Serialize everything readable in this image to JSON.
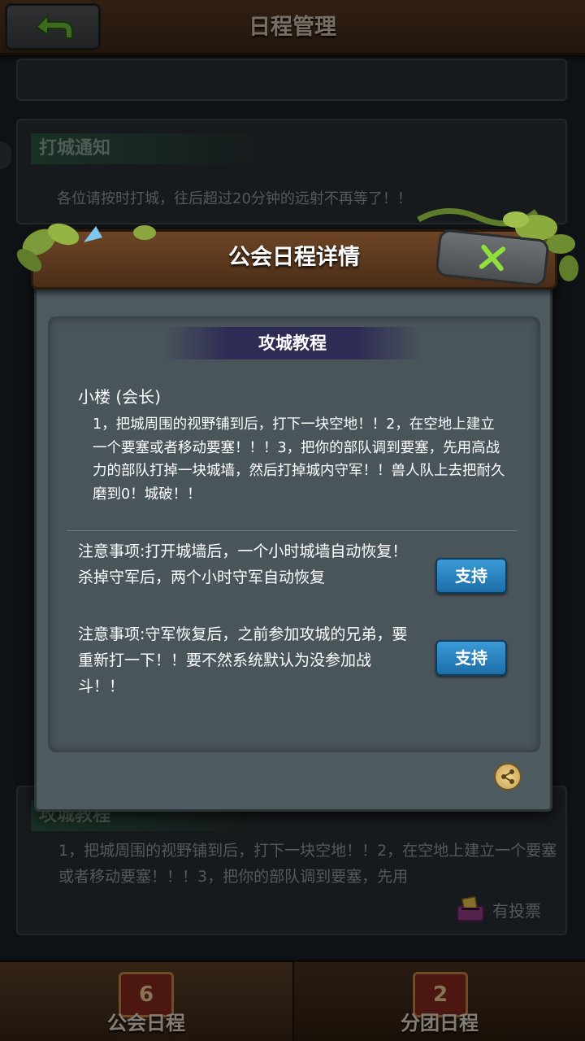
{
  "header": {
    "title": "日程管理"
  },
  "background": {
    "notice_card": {
      "tag": "打城通知",
      "text": "各位请按时打城，往后超过20分钟的远射不再等了！！"
    },
    "tutorial_card": {
      "tag": "攻城教程",
      "text": "1，把城周围的视野铺到后，打下一块空地！！2，在空地上建立一个要塞或者移动要塞！！！3，把你的部队调到要塞，先用",
      "vote_label": "有投票"
    }
  },
  "bottom_nav": {
    "tabs": [
      {
        "label": "公会日程",
        "active": true
      },
      {
        "label": "分团日程",
        "active": false
      }
    ]
  },
  "modal": {
    "title": "公会日程详情",
    "section_title": "攻城教程",
    "author": "小楼 (会长)",
    "body": "1，把城周围的视野铺到后，打下一块空地！！2，在空地上建立一个要塞或者移动要塞！！！3，把你的部队调到要塞，先用高战力的部队打掉一块城墙，然后打掉城内守军！！兽人队上去把耐久磨到0！城破！！",
    "comments": [
      {
        "text": "注意事项:打开城墙后，一个小时城墙自动恢复！杀掉守军后，两个小时守军自动恢复",
        "button": "支持"
      },
      {
        "text": "注意事项:守军恢复后，之前参加攻城的兄弟，要重新打一下！！要不然系统默认为没参加战斗！！",
        "button": "支持"
      }
    ]
  },
  "icons": {
    "back": "back-arrow-icon",
    "close": "close-x-icon",
    "share": "share-icon",
    "vote": "ballot-box-icon"
  },
  "colors": {
    "accent_green": "#7ed321",
    "button_blue": "#2a86c4",
    "wood_brown": "#5a3a22"
  }
}
